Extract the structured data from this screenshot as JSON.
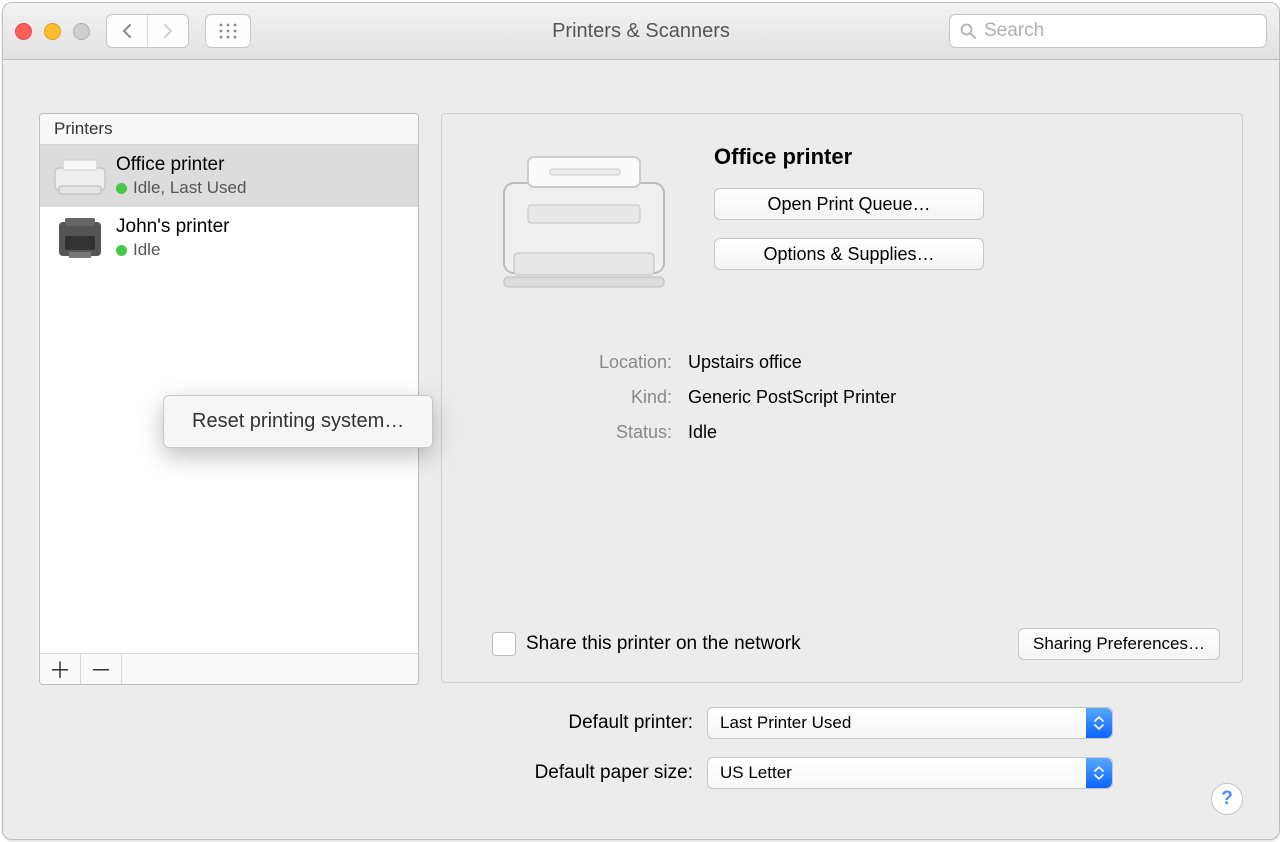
{
  "window": {
    "title": "Printers & Scanners"
  },
  "search": {
    "placeholder": "Search"
  },
  "sidebar": {
    "header": "Printers",
    "items": [
      {
        "name": "Office printer",
        "status": "Idle, Last Used",
        "online": true,
        "selected": true
      },
      {
        "name": "John's printer",
        "status": "Idle",
        "online": true,
        "selected": false
      }
    ]
  },
  "context_menu": {
    "reset_label": "Reset printing system…"
  },
  "details": {
    "title": "Office printer",
    "open_queue_label": "Open Print Queue…",
    "options_label": "Options & Supplies…",
    "location_label": "Location:",
    "location_value": "Upstairs office",
    "kind_label": "Kind:",
    "kind_value": "Generic PostScript Printer",
    "status_label": "Status:",
    "status_value": "Idle",
    "share_label": "Share this printer on the network",
    "share_checked": false,
    "sharing_prefs_label": "Sharing Preferences…"
  },
  "defaults": {
    "printer_label": "Default printer:",
    "printer_value": "Last Printer Used",
    "paper_label": "Default paper size:",
    "paper_value": "US Letter"
  }
}
